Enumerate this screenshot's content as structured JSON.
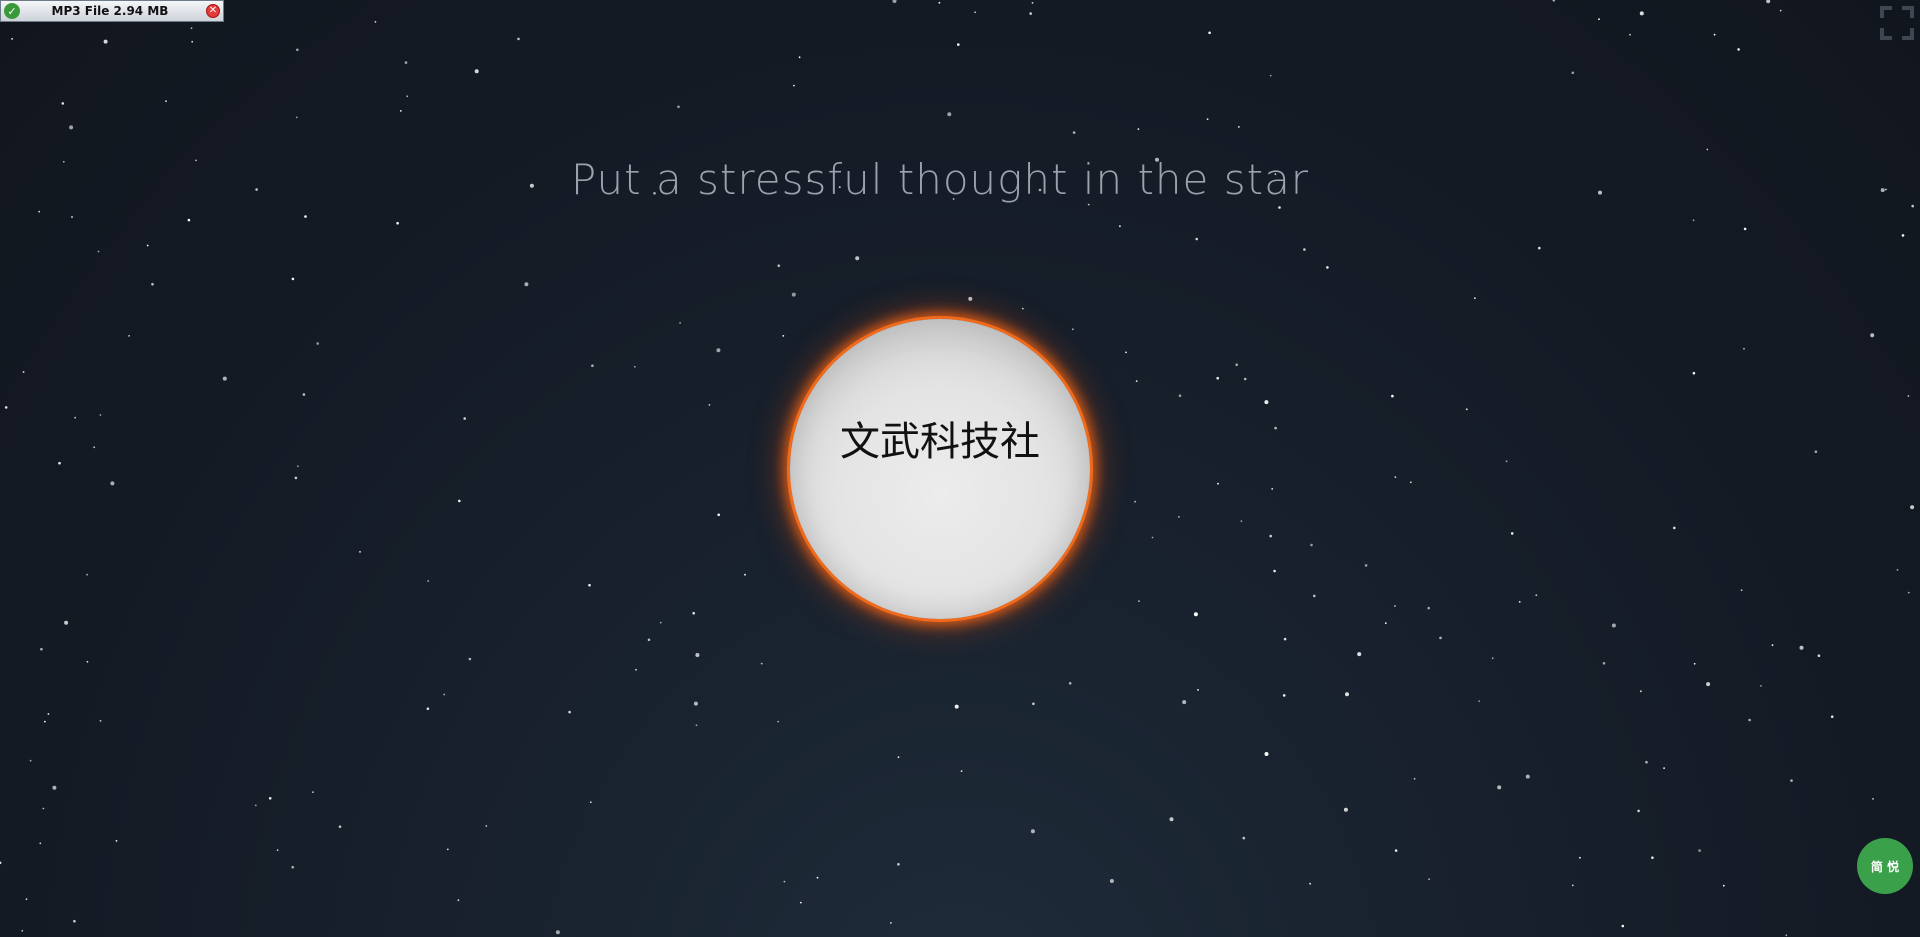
{
  "download_bar": {
    "label": "MP3 File 2.94 MB",
    "icon": "download-app-icon",
    "close_icon": "close-icon"
  },
  "fullscreen": {
    "icon": "fullscreen-icon"
  },
  "prompt": {
    "text": "Put a stressful thought in the star"
  },
  "star": {
    "text": "文武科技社",
    "glow_color": "#f06a1c"
  },
  "lang_button": {
    "label": "简 悦",
    "color": "#3aa14a"
  },
  "colors": {
    "background": "#141a24",
    "prompt_text": "#9aa2ad",
    "star_fill": "#e4e4e4"
  }
}
